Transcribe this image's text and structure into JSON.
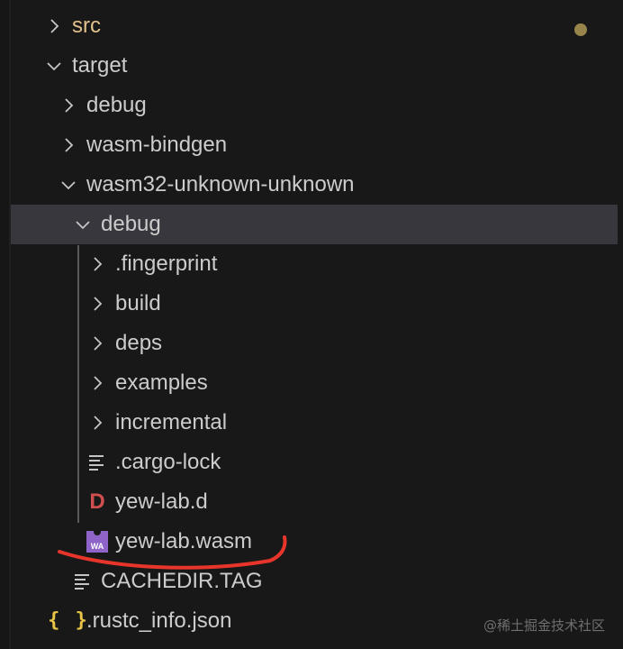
{
  "explorer": {
    "items": [
      {
        "label": "src",
        "type": "folder",
        "expanded": false,
        "modified": true
      },
      {
        "label": "target",
        "type": "folder",
        "expanded": true
      },
      {
        "label": "debug",
        "type": "folder",
        "expanded": false
      },
      {
        "label": "wasm-bindgen",
        "type": "folder",
        "expanded": false
      },
      {
        "label": "wasm32-unknown-unknown",
        "type": "folder",
        "expanded": true
      },
      {
        "label": "debug",
        "type": "folder",
        "expanded": true,
        "selected": true
      },
      {
        "label": ".fingerprint",
        "type": "folder",
        "expanded": false
      },
      {
        "label": "build",
        "type": "folder",
        "expanded": false
      },
      {
        "label": "deps",
        "type": "folder",
        "expanded": false
      },
      {
        "label": "examples",
        "type": "folder",
        "expanded": false
      },
      {
        "label": "incremental",
        "type": "folder",
        "expanded": false
      },
      {
        "label": ".cargo-lock",
        "type": "file",
        "icon": "lines-icon"
      },
      {
        "label": "yew-lab.d",
        "type": "file",
        "icon": "d-file-icon",
        "icon_text": "D"
      },
      {
        "label": "yew-lab.wasm",
        "type": "file",
        "icon": "wasm-icon",
        "icon_text": "WA"
      },
      {
        "label": "CACHEDIR.TAG",
        "type": "file",
        "icon": "lines-icon"
      },
      {
        "label": ".rustc_info.json",
        "type": "file",
        "icon": "json-icon",
        "icon_text": "{ }"
      }
    ]
  },
  "colors": {
    "background": "#181818",
    "selected_row": "#37373d",
    "modified_text": "#e2c08d",
    "annotation": "#e8352b",
    "wasm_icon": "#8f64c9",
    "d_icon": "#cf4f4f",
    "json_icon": "#e8c547"
  },
  "watermark": "@稀土掘金技术社区"
}
